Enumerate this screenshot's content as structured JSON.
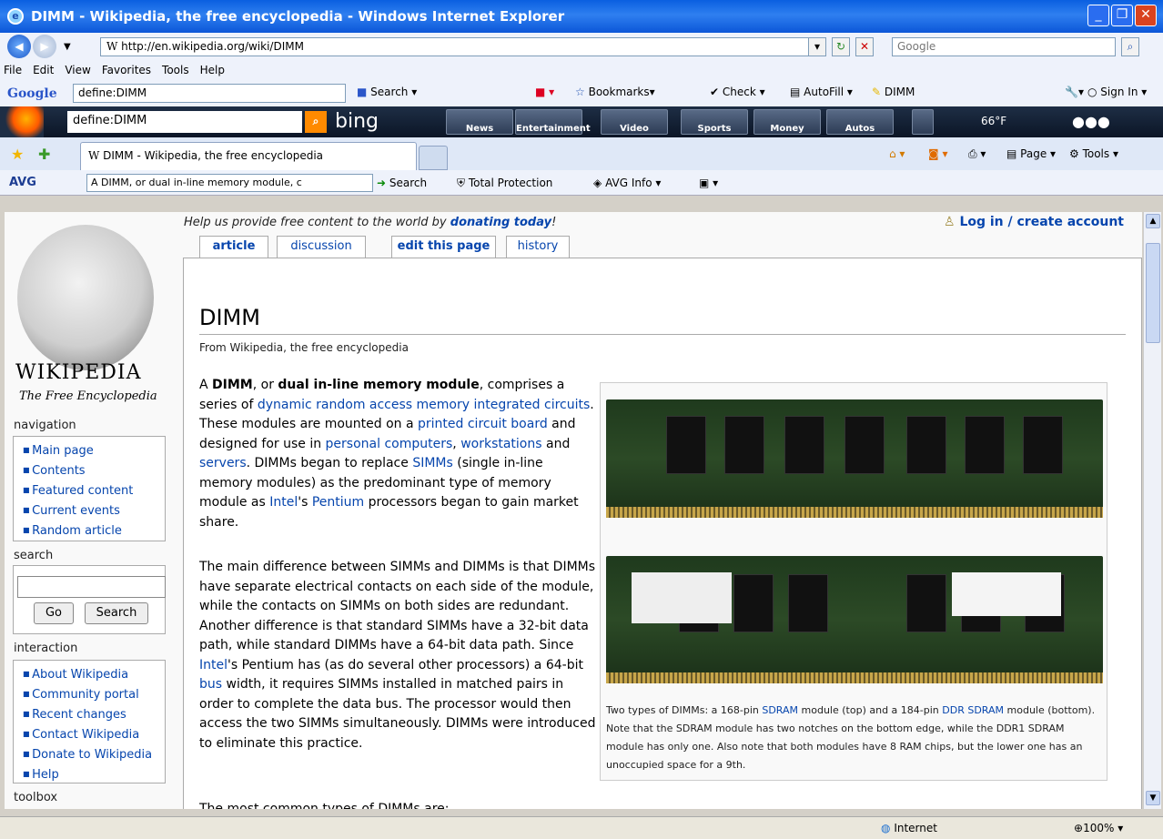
{
  "window": {
    "title": "DIMM - Wikipedia, the free encyclopedia - Windows Internet Explorer"
  },
  "address": {
    "url": "http://en.wikipedia.org/wiki/DIMM",
    "search_placeholder": "Google"
  },
  "menu": [
    "File",
    "Edit",
    "View",
    "Favorites",
    "Tools",
    "Help"
  ],
  "google_toolbar": {
    "logo": "Google",
    "query": "define:DIMM",
    "search": "Search",
    "bookmarks": "Bookmarks",
    "check": "Check",
    "autofill": "AutoFill",
    "dimm": "DIMM",
    "sign_in": "Sign In"
  },
  "bing": {
    "query": "define:DIMM",
    "logo": "bing",
    "tabs": [
      "News",
      "Entertainment",
      "Video",
      "Sports",
      "Money",
      "Autos"
    ],
    "temp": "66°F"
  },
  "tabs": {
    "active": "DIMM - Wikipedia, the free encyclopedia",
    "page": "Page",
    "tools": "Tools"
  },
  "avg": {
    "logo": "AVG",
    "query": "A DIMM, or dual in-line memory module, c",
    "search": "Search",
    "total": "Total Protection",
    "info": "AVG Info"
  },
  "wiki": {
    "wordmark": "WIKIPEDIA",
    "tagline": "The Free Encyclopedia",
    "donate_pre": "Help us provide free content to the world by ",
    "donate_link": "donating today",
    "donate_post": "!",
    "login": "Log in / create account",
    "page_tabs": [
      "article",
      "discussion",
      "edit this page",
      "history"
    ],
    "title": "DIMM",
    "from": "From Wikipedia, the free encyclopedia",
    "nav_heading": "navigation",
    "nav": [
      "Main page",
      "Contents",
      "Featured content",
      "Current events",
      "Random article"
    ],
    "search_heading": "search",
    "go": "Go",
    "search_btn": "Search",
    "interaction_heading": "interaction",
    "interaction": [
      "About Wikipedia",
      "Community portal",
      "Recent changes",
      "Contact Wikipedia",
      "Donate to Wikipedia",
      "Help"
    ],
    "toolbox_heading": "toolbox",
    "p1_a": "A ",
    "p1_b1": "DIMM",
    "p1_c": ", or ",
    "p1_b2": "dual in-line memory module",
    "p1_d": ", comprises a series of ",
    "p1_l1": "dynamic random access memory integrated circuits",
    "p1_e": ". These modules are mounted on a ",
    "p1_l2": "printed circuit board",
    "p1_f": " and designed for use in ",
    "p1_l3": "personal computers",
    "p1_g": ", ",
    "p1_l4": "workstations",
    "p1_h": " and ",
    "p1_l5": "servers",
    "p1_i": ". DIMMs began to replace ",
    "p1_l6": "SIMMs",
    "p1_j": " (single in-line memory modules) as the predominant type of memory module as ",
    "p1_l7": "Intel",
    "p1_k": "'s ",
    "p1_l8": "Pentium",
    "p1_m": " processors began to gain market share.",
    "p2_a": "The main difference between SIMMs and DIMMs is that DIMMs have separate electrical contacts on each side of the module, while the contacts on SIMMs on both sides are redundant. Another difference is that standard SIMMs have a 32-bit data path, while standard DIMMs have a 64-bit data path. Since ",
    "p2_l1": "Intel",
    "p2_b": "'s Pentium has (as do several other processors) a 64-bit ",
    "p2_l2": "bus",
    "p2_c": " width, it requires SIMMs installed in matched pairs in order to complete the data bus. The processor would then access the two SIMMs simultaneously. DIMMs were introduced to eliminate this practice.",
    "p3": "The most common types of DIMMs are:",
    "cap_a": "Two types of DIMMs: a 168-pin ",
    "cap_l1": "SDRAM",
    "cap_b": " module (top) and a 184-pin ",
    "cap_l2": "DDR SDRAM",
    "cap_c": " module (bottom). Note that the SDRAM module has two notches on the bottom edge, while the DDR1 SDRAM module has only one. Also note that both modules have 8 RAM chips, but the lower one has an unoccupied space for a 9th."
  },
  "status": {
    "zone": "Internet",
    "zoom": "100%"
  }
}
